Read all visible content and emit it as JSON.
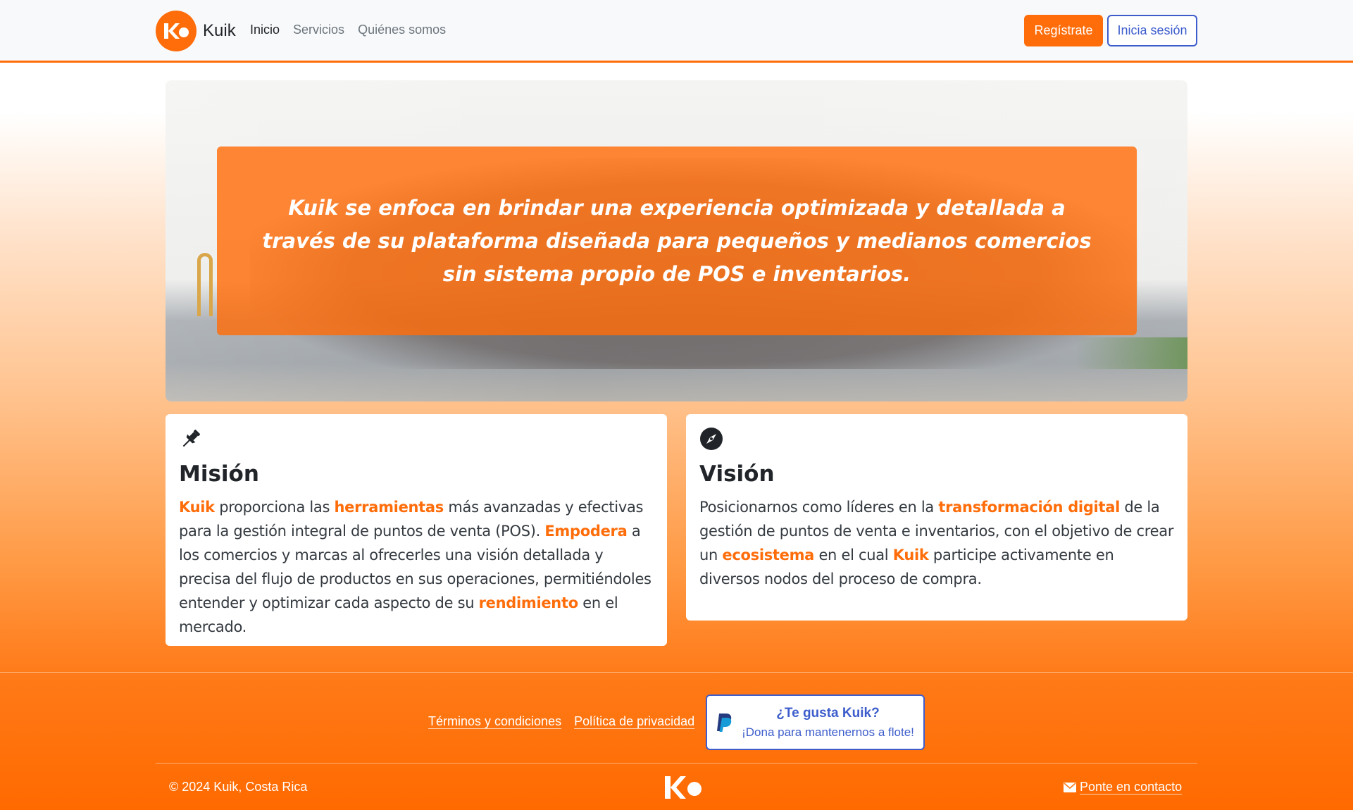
{
  "navbar": {
    "brand": "Kuik",
    "links": [
      "Inicio",
      "Servicios",
      "Quiénes somos"
    ],
    "register_label": "Regístrate",
    "login_label": "Inicia sesión"
  },
  "hero": {
    "text": "Kuik se enfoca en brindar una experiencia optimizada y detallada a través de su plataforma diseñada para pequeños y medianos comercios sin sistema propio de POS e inventarios."
  },
  "mision": {
    "icon": "pushpin-icon",
    "title": "Misión",
    "parts": [
      {
        "hl": "Kuik"
      },
      {
        "t": " proporciona las "
      },
      {
        "hl": "herramientas"
      },
      {
        "t": " más avanzadas y efectivas para la gestión integral de puntos de venta (POS). "
      },
      {
        "hl": "Empodera"
      },
      {
        "t": " a los comercios y marcas al ofrecerles una visión detallada y precisa del flujo de productos en sus operaciones, permitiéndoles entender y optimizar cada aspecto de su "
      },
      {
        "hl": "rendimiento"
      },
      {
        "t": " en el mercado."
      }
    ]
  },
  "vision": {
    "icon": "compass-icon",
    "title": "Visión",
    "parts": [
      {
        "t": "Posicionarnos como líderes en la "
      },
      {
        "hl": "transformación digital"
      },
      {
        "t": " de la gestión de puntos de venta e inventarios, con el objetivo de crear un "
      },
      {
        "hl": "ecosistema"
      },
      {
        "t": " en el cual "
      },
      {
        "hl": "Kuik"
      },
      {
        "t": " participe activamente en diversos nodos del proceso de compra."
      }
    ]
  },
  "footer": {
    "links": [
      "Términos y condiciones",
      "Política de privacidad"
    ],
    "donate_title": "¿Te gusta Kuik?",
    "donate_sub": "¡Dona para mantenernos a flote!",
    "copyright": "© 2024 Kuik, Costa Rica",
    "contact": "Ponte en contacto"
  },
  "colors": {
    "accent": "#ff6d0a",
    "link_blue": "#3d5dcc"
  }
}
